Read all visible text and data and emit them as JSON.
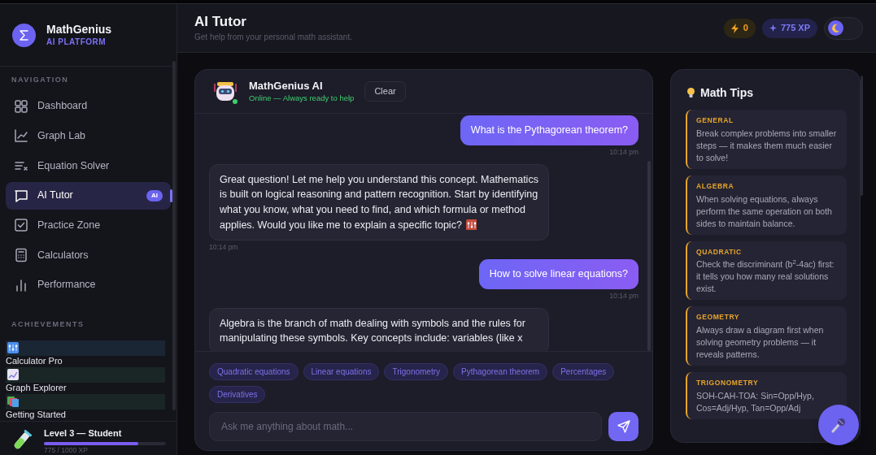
{
  "brand": {
    "name": "MathGenius",
    "tagline": "AI PLATFORM"
  },
  "sidebar": {
    "nav_heading": "NAVIGATION",
    "items": [
      {
        "label": "Dashboard",
        "selected": false
      },
      {
        "label": "Graph Lab",
        "selected": false
      },
      {
        "label": "Equation Solver",
        "selected": false
      },
      {
        "label": "AI Tutor",
        "selected": true,
        "badge": "AI"
      },
      {
        "label": "Practice Zone",
        "selected": false
      },
      {
        "label": "Calculators",
        "selected": false
      },
      {
        "label": "Performance",
        "selected": false
      }
    ],
    "achievements_heading": "ACHIEVEMENTS",
    "achievements": [
      {
        "label": "Calculator Pro"
      },
      {
        "label": "Graph Explorer"
      },
      {
        "label": "Getting Started"
      }
    ],
    "level": {
      "title": "Level 3 — Student",
      "level": 0.775,
      "reading": "775 / 1000 XP"
    }
  },
  "header": {
    "title": "AI Tutor",
    "subtitle": "Get help from your personal math assistant.",
    "streak": "0",
    "xp": "775 XP",
    "light_mode": false
  },
  "chat": {
    "name": "MathGenius AI",
    "status": "Online — Always ready to help",
    "clear_button": "Clear",
    "messages": [
      {
        "kind": "user",
        "text": "What is the Pythagorean theorem?",
        "time": "10:14 pm"
      },
      {
        "kind": "assistant",
        "text": "Great question! Let me help you understand this concept. Mathematics is built on logical reasoning and pattern recognition. Start by identifying what you know, what you need to find, and which formula or method applies. Would you like me to explain a specific topic?",
        "time": "10:14 pm"
      },
      {
        "kind": "user",
        "text": "How to solve linear equations?",
        "time": "10:14 pm"
      },
      {
        "kind": "assistant",
        "text": "Algebra is the branch of math dealing with symbols and the rules for manipulating these symbols. Key concepts include: variables (like x"
      }
    ],
    "suggestions": [
      "Quadratic equations",
      "Linear equations",
      "Trigonometry",
      "Pythagorean theorem",
      "Percentages",
      "Derivatives"
    ],
    "input": {
      "placeholder": "Ask me anything about math..."
    }
  },
  "tips": {
    "title": "Math Tips",
    "items": [
      {
        "category": "GENERAL",
        "text": "Break complex problems into smaller steps — it makes them much easier to solve!"
      },
      {
        "category": "ALGEBRA",
        "text": "When solving equations, always perform the same operation on both sides to maintain balance."
      },
      {
        "category": "QUADRATIC",
        "text": "Check the discriminant (b$^{2}$-4ac) first: it tells you how many real solutions exist."
      },
      {
        "category": "GEOMETRY",
        "text": "Always draw a diagram first when solving geometry problems — it reveals patterns."
      },
      {
        "category": "TRIGONOMETRY",
        "text": "SOH-CAH-TOA: Sin=Opp/Hyp, Cos=Adj/Hyp, Tan=Opp/Adj"
      }
    ]
  }
}
